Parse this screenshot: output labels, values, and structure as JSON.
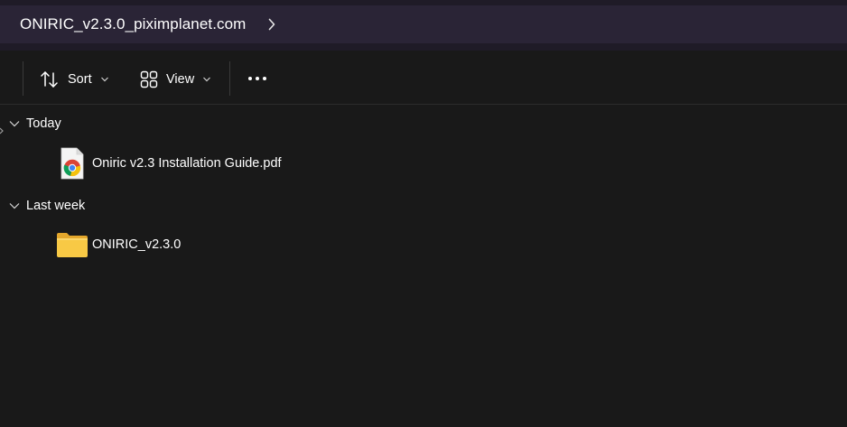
{
  "breadcrumb": {
    "path": "ONIRIC_v2.3.0_piximplanet.com",
    "chevron_icon": "chevron-right-icon"
  },
  "toolbar": {
    "sort_label": "Sort",
    "sort_icon": "sort-arrows-icon",
    "view_label": "View",
    "view_icon": "view-grid-icon",
    "more_icon": "more-options-icon"
  },
  "groups": [
    {
      "label": "Today",
      "items": [
        {
          "name": "Oniric v2.3 Installation Guide.pdf",
          "icon": "chrome-pdf-file-icon"
        }
      ]
    },
    {
      "label": "Last week",
      "items": [
        {
          "name": "ONIRIC_v2.3.0",
          "icon": "folder-icon"
        }
      ]
    }
  ],
  "colors": {
    "background": "#191919",
    "breadcrumb_bar": "#2a2436",
    "folder_yellow": "#f6c33a",
    "text": "#ffffff"
  }
}
